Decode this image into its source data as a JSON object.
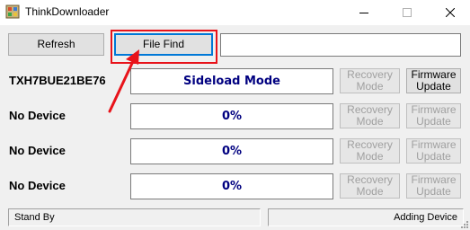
{
  "window": {
    "title": "ThinkDownloader",
    "minimize_glyph": "—",
    "maximize_glyph": "☐",
    "close_glyph": "✕"
  },
  "toolbar": {
    "refresh_label": "Refresh",
    "file_find_label": "File Find",
    "file_path_value": ""
  },
  "devices": [
    {
      "label": "TXH7BUE21BE76",
      "status": "Sideload Mode",
      "recovery_label": "Recovery Mode",
      "recovery_enabled": false,
      "firmware_label": "Firmware Update",
      "firmware_enabled": true
    },
    {
      "label": "No Device",
      "status": "0%",
      "recovery_label": "Recovery Mode",
      "recovery_enabled": false,
      "firmware_label": "Firmware Update",
      "firmware_enabled": false
    },
    {
      "label": "No Device",
      "status": "0%",
      "recovery_label": "Recovery Mode",
      "recovery_enabled": false,
      "firmware_label": "Firmware Update",
      "firmware_enabled": false
    },
    {
      "label": "No Device",
      "status": "0%",
      "recovery_label": "Recovery Mode",
      "recovery_enabled": false,
      "firmware_label": "Firmware Update",
      "firmware_enabled": false
    }
  ],
  "statusbar": {
    "left": "Stand By",
    "right": "Adding Device"
  },
  "colors": {
    "annotation": "#e8131a",
    "status_text": "#000080"
  },
  "icons": {
    "app": "app-icon",
    "annotation_arrow": "red-arrow-icon"
  }
}
